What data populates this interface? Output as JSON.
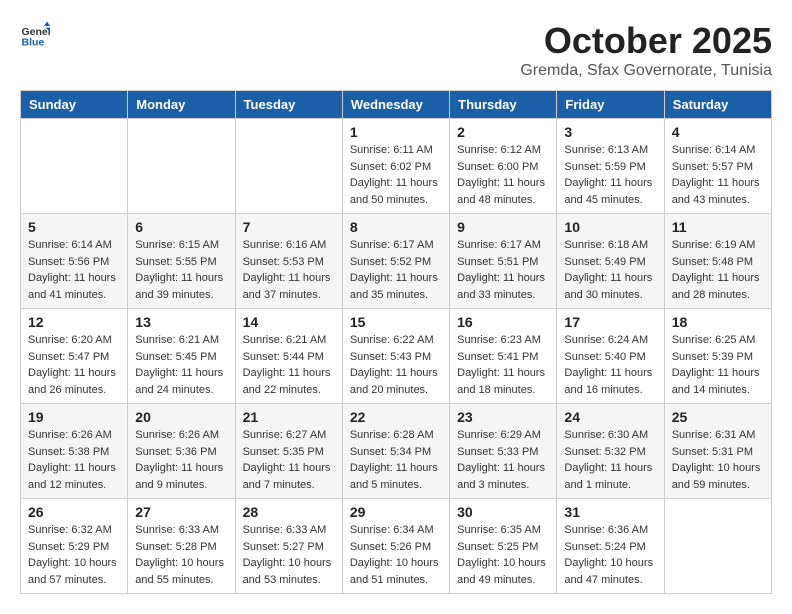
{
  "header": {
    "logo_general": "General",
    "logo_blue": "Blue",
    "month_title": "October 2025",
    "location": "Gremda, Sfax Governorate, Tunisia"
  },
  "days_of_week": [
    "Sunday",
    "Monday",
    "Tuesday",
    "Wednesday",
    "Thursday",
    "Friday",
    "Saturday"
  ],
  "weeks": [
    [
      {
        "day": "",
        "info": ""
      },
      {
        "day": "",
        "info": ""
      },
      {
        "day": "",
        "info": ""
      },
      {
        "day": "1",
        "info": "Sunrise: 6:11 AM\nSunset: 6:02 PM\nDaylight: 11 hours\nand 50 minutes."
      },
      {
        "day": "2",
        "info": "Sunrise: 6:12 AM\nSunset: 6:00 PM\nDaylight: 11 hours\nand 48 minutes."
      },
      {
        "day": "3",
        "info": "Sunrise: 6:13 AM\nSunset: 5:59 PM\nDaylight: 11 hours\nand 45 minutes."
      },
      {
        "day": "4",
        "info": "Sunrise: 6:14 AM\nSunset: 5:57 PM\nDaylight: 11 hours\nand 43 minutes."
      }
    ],
    [
      {
        "day": "5",
        "info": "Sunrise: 6:14 AM\nSunset: 5:56 PM\nDaylight: 11 hours\nand 41 minutes."
      },
      {
        "day": "6",
        "info": "Sunrise: 6:15 AM\nSunset: 5:55 PM\nDaylight: 11 hours\nand 39 minutes."
      },
      {
        "day": "7",
        "info": "Sunrise: 6:16 AM\nSunset: 5:53 PM\nDaylight: 11 hours\nand 37 minutes."
      },
      {
        "day": "8",
        "info": "Sunrise: 6:17 AM\nSunset: 5:52 PM\nDaylight: 11 hours\nand 35 minutes."
      },
      {
        "day": "9",
        "info": "Sunrise: 6:17 AM\nSunset: 5:51 PM\nDaylight: 11 hours\nand 33 minutes."
      },
      {
        "day": "10",
        "info": "Sunrise: 6:18 AM\nSunset: 5:49 PM\nDaylight: 11 hours\nand 30 minutes."
      },
      {
        "day": "11",
        "info": "Sunrise: 6:19 AM\nSunset: 5:48 PM\nDaylight: 11 hours\nand 28 minutes."
      }
    ],
    [
      {
        "day": "12",
        "info": "Sunrise: 6:20 AM\nSunset: 5:47 PM\nDaylight: 11 hours\nand 26 minutes."
      },
      {
        "day": "13",
        "info": "Sunrise: 6:21 AM\nSunset: 5:45 PM\nDaylight: 11 hours\nand 24 minutes."
      },
      {
        "day": "14",
        "info": "Sunrise: 6:21 AM\nSunset: 5:44 PM\nDaylight: 11 hours\nand 22 minutes."
      },
      {
        "day": "15",
        "info": "Sunrise: 6:22 AM\nSunset: 5:43 PM\nDaylight: 11 hours\nand 20 minutes."
      },
      {
        "day": "16",
        "info": "Sunrise: 6:23 AM\nSunset: 5:41 PM\nDaylight: 11 hours\nand 18 minutes."
      },
      {
        "day": "17",
        "info": "Sunrise: 6:24 AM\nSunset: 5:40 PM\nDaylight: 11 hours\nand 16 minutes."
      },
      {
        "day": "18",
        "info": "Sunrise: 6:25 AM\nSunset: 5:39 PM\nDaylight: 11 hours\nand 14 minutes."
      }
    ],
    [
      {
        "day": "19",
        "info": "Sunrise: 6:26 AM\nSunset: 5:38 PM\nDaylight: 11 hours\nand 12 minutes."
      },
      {
        "day": "20",
        "info": "Sunrise: 6:26 AM\nSunset: 5:36 PM\nDaylight: 11 hours\nand 9 minutes."
      },
      {
        "day": "21",
        "info": "Sunrise: 6:27 AM\nSunset: 5:35 PM\nDaylight: 11 hours\nand 7 minutes."
      },
      {
        "day": "22",
        "info": "Sunrise: 6:28 AM\nSunset: 5:34 PM\nDaylight: 11 hours\nand 5 minutes."
      },
      {
        "day": "23",
        "info": "Sunrise: 6:29 AM\nSunset: 5:33 PM\nDaylight: 11 hours\nand 3 minutes."
      },
      {
        "day": "24",
        "info": "Sunrise: 6:30 AM\nSunset: 5:32 PM\nDaylight: 11 hours\nand 1 minute."
      },
      {
        "day": "25",
        "info": "Sunrise: 6:31 AM\nSunset: 5:31 PM\nDaylight: 10 hours\nand 59 minutes."
      }
    ],
    [
      {
        "day": "26",
        "info": "Sunrise: 6:32 AM\nSunset: 5:29 PM\nDaylight: 10 hours\nand 57 minutes."
      },
      {
        "day": "27",
        "info": "Sunrise: 6:33 AM\nSunset: 5:28 PM\nDaylight: 10 hours\nand 55 minutes."
      },
      {
        "day": "28",
        "info": "Sunrise: 6:33 AM\nSunset: 5:27 PM\nDaylight: 10 hours\nand 53 minutes."
      },
      {
        "day": "29",
        "info": "Sunrise: 6:34 AM\nSunset: 5:26 PM\nDaylight: 10 hours\nand 51 minutes."
      },
      {
        "day": "30",
        "info": "Sunrise: 6:35 AM\nSunset: 5:25 PM\nDaylight: 10 hours\nand 49 minutes."
      },
      {
        "day": "31",
        "info": "Sunrise: 6:36 AM\nSunset: 5:24 PM\nDaylight: 10 hours\nand 47 minutes."
      },
      {
        "day": "",
        "info": ""
      }
    ]
  ]
}
